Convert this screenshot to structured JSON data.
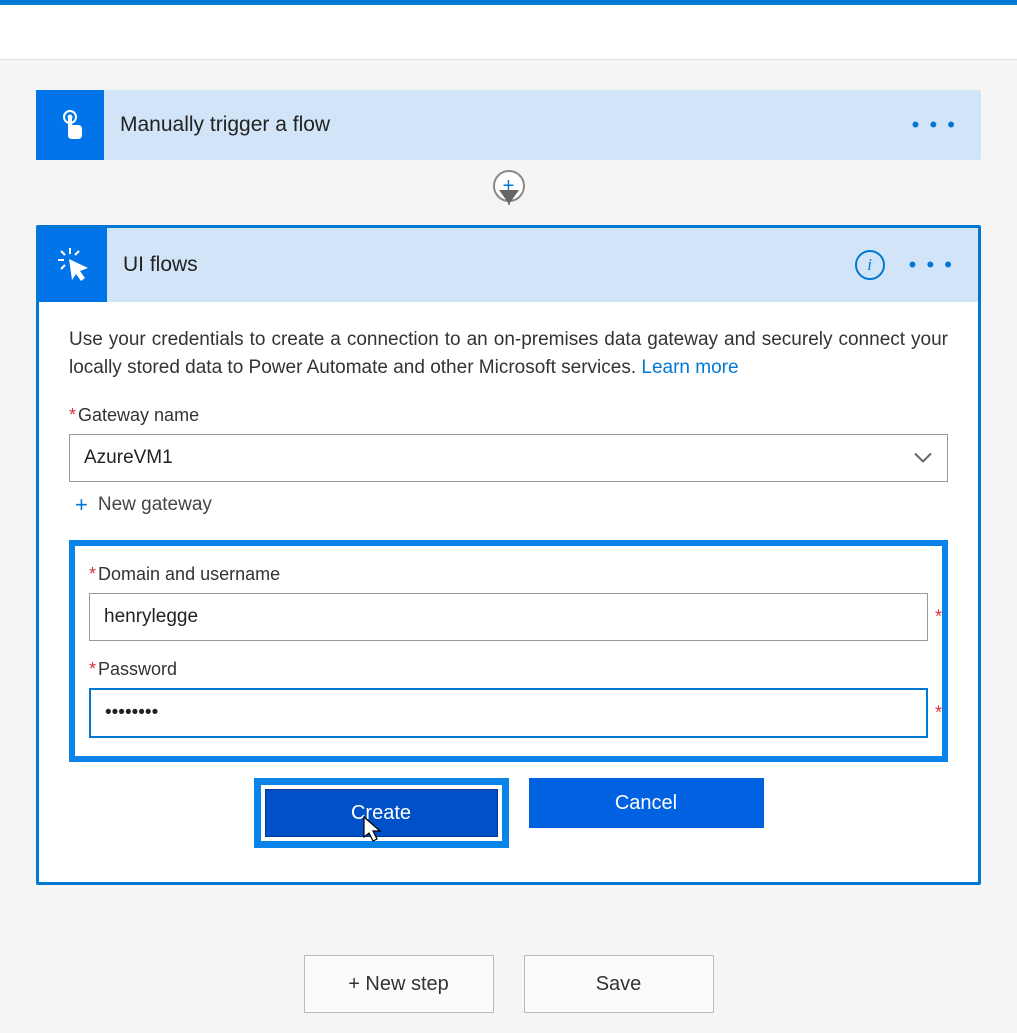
{
  "trigger": {
    "title": "Manually trigger a flow",
    "icon": "touch-icon",
    "more": "• • •"
  },
  "action": {
    "title": "UI flows",
    "icon": "cursor-click-icon",
    "info": "i",
    "more": "• • •",
    "description_prefix": "Use your credentials to create a connection to an on-premises data gateway and securely connect your locally stored data to Power Automate and other Microsoft services. ",
    "learn_more": "Learn more",
    "gateway_label": "Gateway name",
    "gateway_value": "AzureVM1",
    "new_gateway_label": "New gateway",
    "domain_label": "Domain and username",
    "domain_value": "henrylegge",
    "password_label": "Password",
    "password_value": "••••••••",
    "create_btn": "Create",
    "cancel_btn": "Cancel"
  },
  "footer": {
    "new_step": "+ New step",
    "save": "Save"
  }
}
